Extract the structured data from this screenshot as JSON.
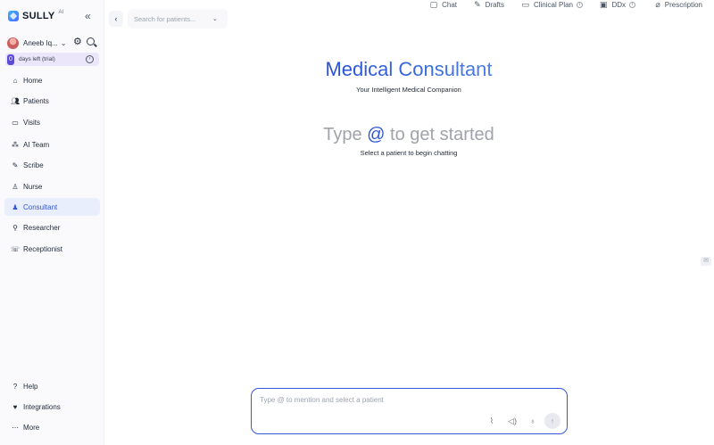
{
  "brand": {
    "name": "SULLY",
    "suffix": "AI"
  },
  "icons": {
    "collapse": "double-chevron-left-icon",
    "gear": "gear-icon",
    "search": "search-icon"
  },
  "user": {
    "name": "Aneeb Iq...",
    "avatar": "avatar"
  },
  "trial": {
    "count": "0",
    "text": "days left (trial)"
  },
  "nav": {
    "main": [
      {
        "label": "Home",
        "icon": "home-icon",
        "active": false
      },
      {
        "label": "Patients",
        "icon": "patients-icon",
        "active": false
      },
      {
        "label": "Visits",
        "icon": "calendar-icon",
        "active": false
      },
      {
        "label": "AI Team",
        "icon": "team-icon",
        "active": false
      },
      {
        "label": "Scribe",
        "icon": "scribe-icon",
        "active": false
      },
      {
        "label": "Nurse",
        "icon": "nurse-icon",
        "active": false
      },
      {
        "label": "Consultant",
        "icon": "consultant-icon",
        "active": true
      },
      {
        "label": "Researcher",
        "icon": "researcher-icon",
        "active": false
      },
      {
        "label": "Receptionist",
        "icon": "receptionist-icon",
        "active": false
      }
    ],
    "bottom": [
      {
        "label": "Help",
        "icon": "help-icon"
      },
      {
        "label": "Integrations",
        "icon": "integrations-icon"
      },
      {
        "label": "More",
        "icon": "more-icon"
      }
    ]
  },
  "topbar": {
    "search_placeholder": "Search for patients...",
    "tabs": [
      {
        "label": "Chat",
        "icon": "chat-icon",
        "info": false
      },
      {
        "label": "Drafts",
        "icon": "pencil-icon",
        "info": false
      },
      {
        "label": "Clinical Plan",
        "icon": "clipboard-icon",
        "info": true
      },
      {
        "label": "DDx",
        "icon": "ddx-icon",
        "info": true
      },
      {
        "label": "Prescription",
        "icon": "pill-icon",
        "info": false
      }
    ]
  },
  "main": {
    "title": "Medical Consultant",
    "subtitle": "Your Intelligent Medical Companion",
    "prompt_before": "Type",
    "prompt_at": "@",
    "prompt_after": "to get started",
    "hint": "Select a patient to begin chatting"
  },
  "composer": {
    "placeholder": "Type @ to mention and select a patient",
    "buttons": [
      "attach-icon",
      "speaker-icon",
      "microphone-icon",
      "send-icon"
    ]
  },
  "colors": {
    "accent": "#3457d5",
    "active_bg": "#e8eefc",
    "trial_bg": "#ece6fb"
  }
}
